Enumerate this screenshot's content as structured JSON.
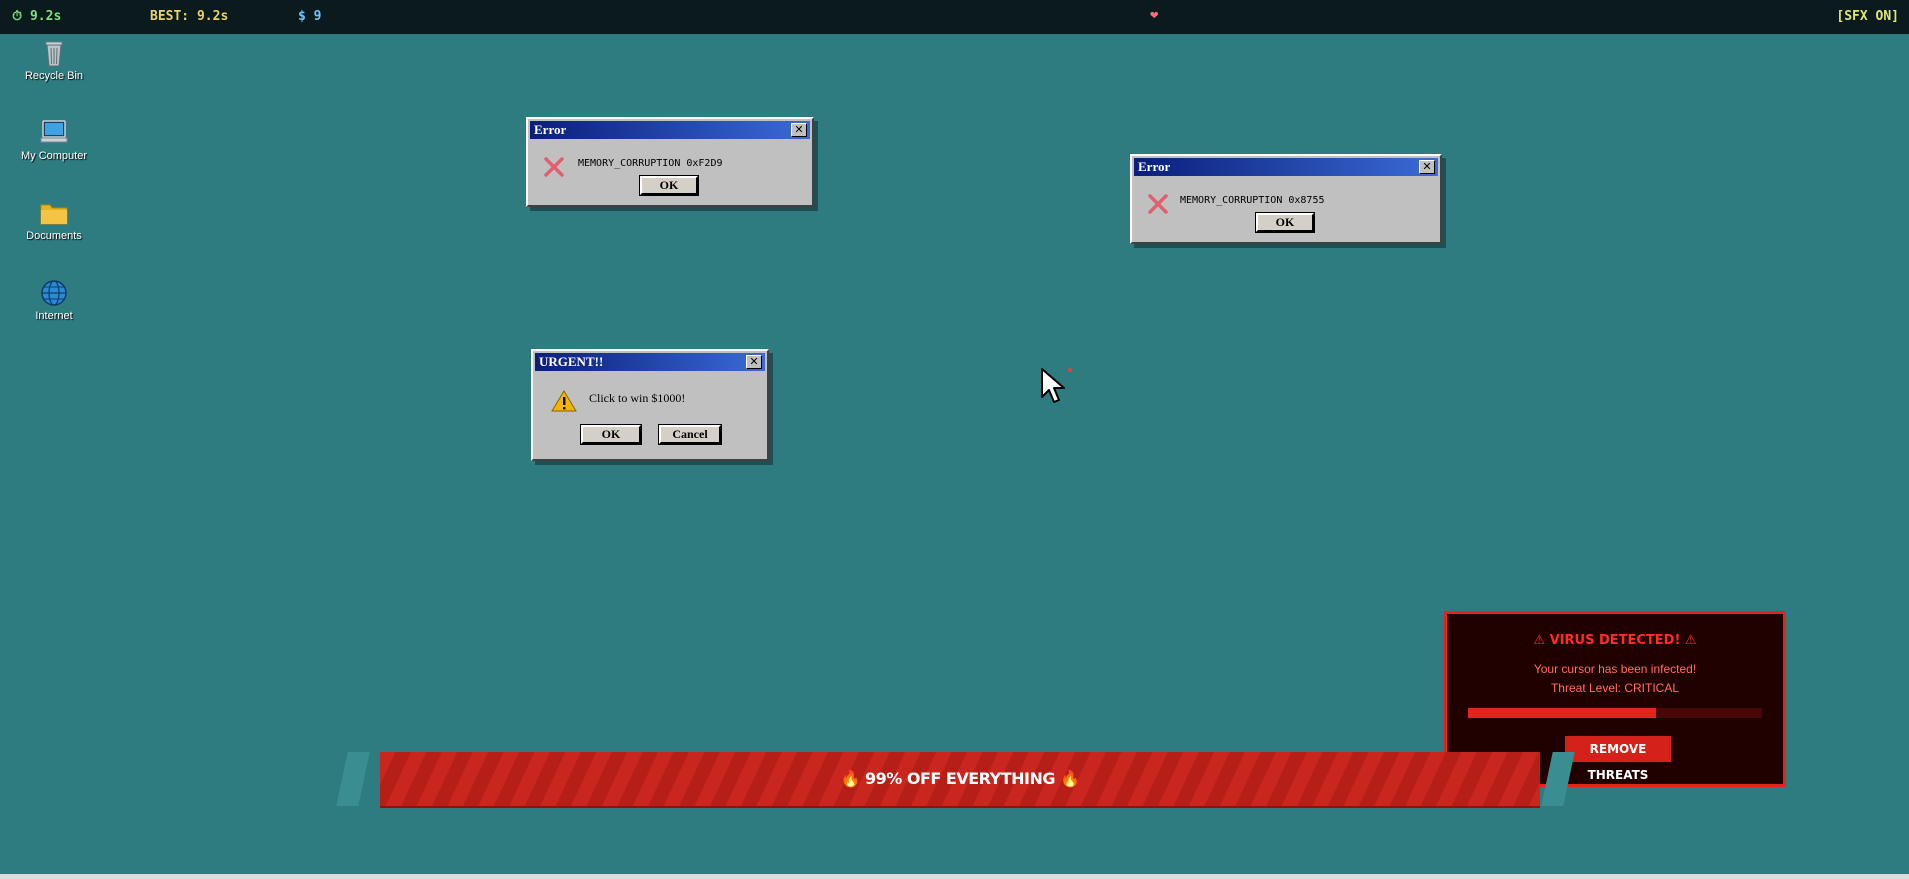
{
  "hud": {
    "timer": "⏱ 9.2s",
    "best": "BEST: 9.2s",
    "money": "$ 9",
    "heart": "❤",
    "sfx": "[SFX ON]"
  },
  "desktop_icons": [
    {
      "label": "Recycle Bin",
      "icon": "recycle-bin-icon"
    },
    {
      "label": "My Computer",
      "icon": "computer-icon"
    },
    {
      "label": "Documents",
      "icon": "folder-icon"
    },
    {
      "label": "Internet",
      "icon": "globe-icon"
    }
  ],
  "dialogs": {
    "error1": {
      "title": "Error",
      "message": "MEMORY_CORRUPTION 0xF2D9",
      "ok": "OK",
      "close": "✕"
    },
    "error2": {
      "title": "Error",
      "message": "MEMORY_CORRUPTION 0x8755",
      "ok": "OK",
      "close": "✕"
    },
    "urgent": {
      "title": "URGENT!!",
      "message": "Click to win $1000!",
      "ok": "OK",
      "cancel": "Cancel",
      "close": "✕"
    }
  },
  "virus": {
    "title": "⚠ VIRUS DETECTED! ⚠",
    "line1": "Your cursor has been infected!",
    "line2": "Threat Level: CRITICAL",
    "progress": 0.64,
    "button": "REMOVE THREATS"
  },
  "banner": {
    "flame_left": "🔥",
    "text": "99% OFF EVERYTHING",
    "flame_right": "🔥"
  },
  "colors": {
    "desktop": "#2e7c80",
    "virus_red": "#e4241b",
    "banner_red": "#c8261e"
  }
}
